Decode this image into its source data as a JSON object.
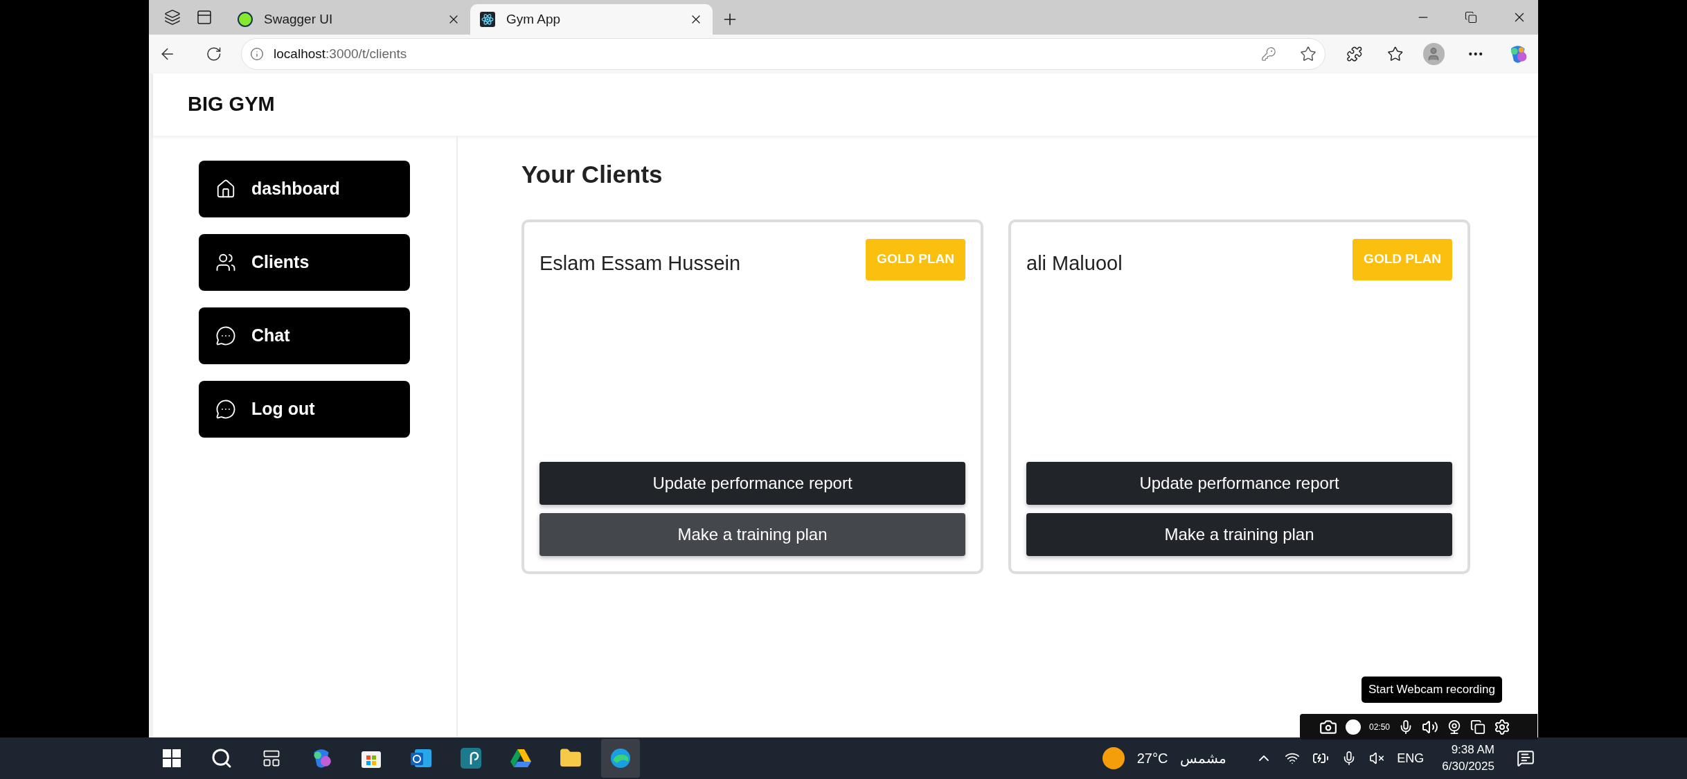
{
  "browser": {
    "tabs": [
      {
        "title": "Swagger UI",
        "kind": "swagger",
        "selected": false
      },
      {
        "title": "Gym App",
        "kind": "react",
        "selected": true
      }
    ],
    "address": {
      "host": "localhost",
      "path": ":3000/t/clients"
    }
  },
  "header": {
    "brand": "BIG GYM"
  },
  "sidebar": {
    "items": [
      {
        "label": "dashboard",
        "kind": "home"
      },
      {
        "label": "Clients",
        "kind": "users"
      },
      {
        "label": "Chat",
        "kind": "chat"
      },
      {
        "label": "Log out",
        "kind": "chat"
      }
    ]
  },
  "main": {
    "title": "Your Clients",
    "clients": [
      {
        "name": "Eslam Essam Hussein",
        "plan": "GOLD PLAN",
        "buttons": [
          {
            "label": "Update performance report",
            "hovered": false
          },
          {
            "label": "Make a training plan",
            "hovered": true
          }
        ]
      },
      {
        "name": "ali Maluool",
        "plan": "GOLD PLAN",
        "buttons": [
          {
            "label": "Update performance report",
            "hovered": false
          },
          {
            "label": "Make a training plan",
            "hovered": false
          }
        ]
      }
    ]
  },
  "recorder": {
    "timer": "02:50",
    "tooltip": "Start Webcam recording"
  },
  "taskbar": {
    "weather": {
      "temperature": "27°C",
      "condition": "مشمس"
    },
    "language": "ENG",
    "time": "9:38 AM",
    "date": "6/30/2025"
  }
}
